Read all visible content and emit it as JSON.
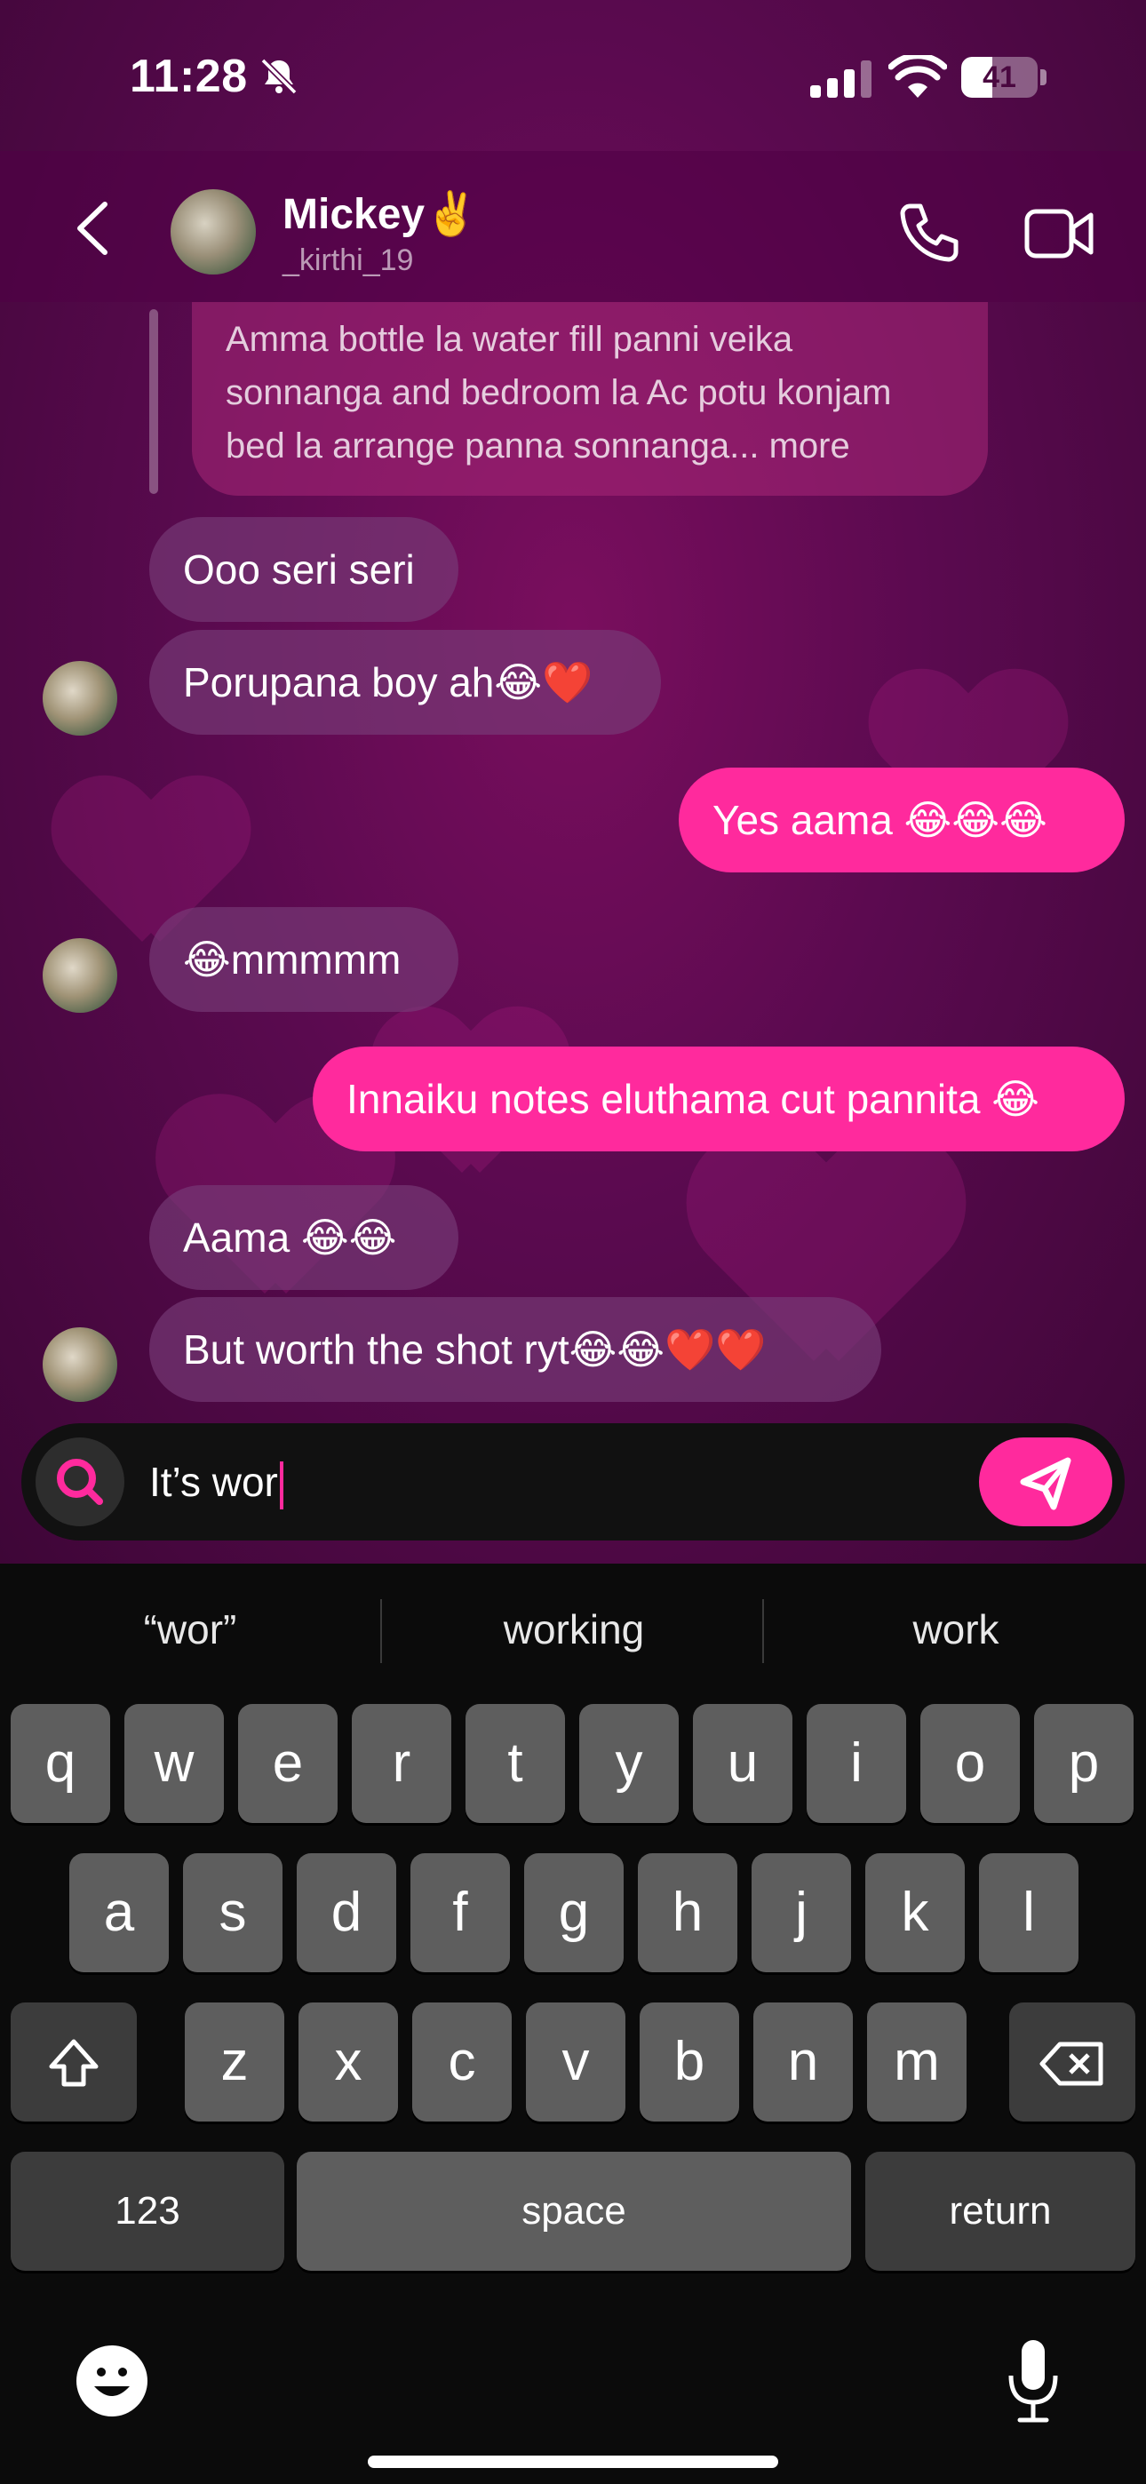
{
  "status_bar": {
    "time": "11:28",
    "battery": "41",
    "battery_level": 0.41
  },
  "header": {
    "contact_name": "Mickey✌️",
    "contact_handle": "_kirthi_19"
  },
  "messages": {
    "reply_preview": "Amma bottle la water fill panni veika sonnanga and bedroom la Ac potu konjam bed la arrange panna sonnanga... more",
    "m1": "Ooo seri seri",
    "m2": "Porupana boy ah😂❤️",
    "m3": "Yes aama 😂😂😂",
    "m4": "😂mmmmm",
    "m5": "Innaiku notes eluthama cut pannita 😂",
    "m6": "Aama 😂😂",
    "m7": "But worth the shot ryt😂😂❤️❤️"
  },
  "composer": {
    "value": "It’s wor"
  },
  "keyboard": {
    "suggestions": [
      "“wor”",
      "working",
      "work"
    ],
    "row1": [
      "q",
      "w",
      "e",
      "r",
      "t",
      "y",
      "u",
      "i",
      "o",
      "p"
    ],
    "row2": [
      "a",
      "s",
      "d",
      "f",
      "g",
      "h",
      "j",
      "k",
      "l"
    ],
    "row3": [
      "z",
      "x",
      "c",
      "v",
      "b",
      "n",
      "m"
    ],
    "numbers_label": "123",
    "space_label": "space",
    "return_label": "return"
  },
  "colors": {
    "accent": "#ff2a9d",
    "chat_bg": "#5a0a4f"
  }
}
